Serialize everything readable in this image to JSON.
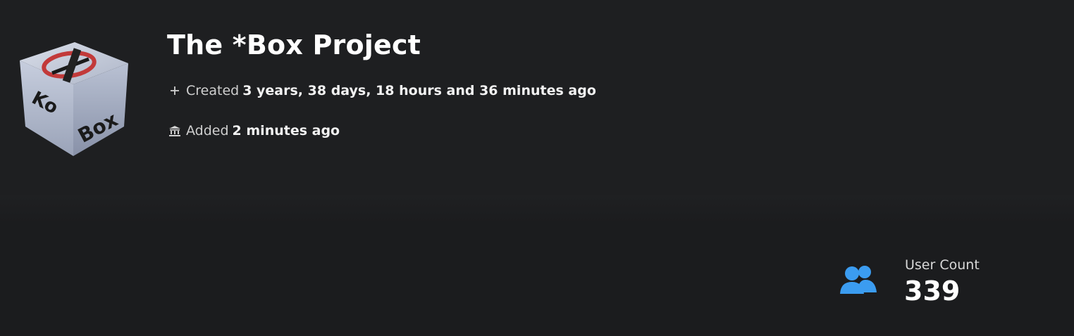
{
  "project": {
    "title": "The *Box Project",
    "logo_text": "Ko Box",
    "created_label": "Created",
    "created_value": "3 years, 38 days, 18 hours and 36 minutes ago",
    "added_label": "Added",
    "added_value": "2 minutes ago"
  },
  "stats": {
    "user_count_label": "User Count",
    "user_count_value": "339"
  },
  "icons": {
    "created": "plus-icon",
    "added": "institution-icon",
    "users": "users-icon"
  },
  "colors": {
    "background": "#1b1c1e",
    "header": "#1e1f21",
    "accent": "#3b9cf0"
  }
}
